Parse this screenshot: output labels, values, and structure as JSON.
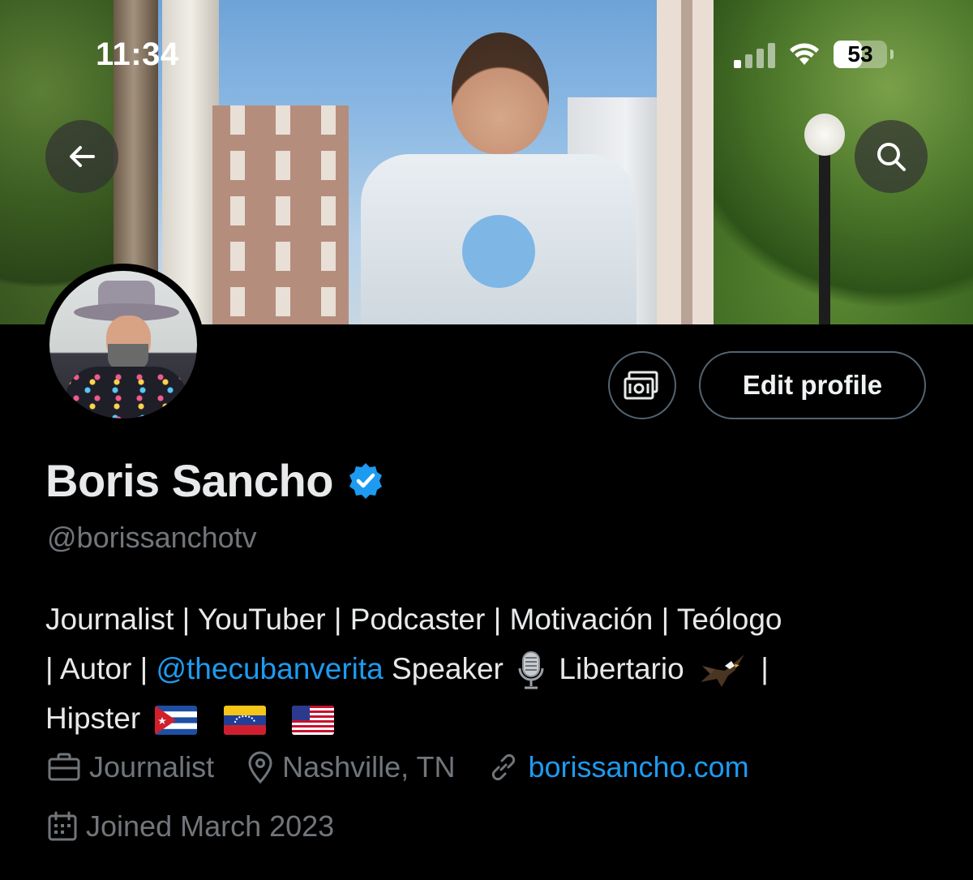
{
  "status_bar": {
    "time": "11:34",
    "battery": "53",
    "battery_level_percent": 53,
    "signal_bars_active": 1,
    "signal_bars_total": 4
  },
  "banner": {
    "description_icons": [
      "back-arrow-icon",
      "search-icon"
    ]
  },
  "profile": {
    "display_name": "Boris Sancho",
    "verified": true,
    "verified_color": "#1d9bf0",
    "handle": "@borissanchotv",
    "edit_button_label": "Edit profile",
    "bio_parts": {
      "line1": "Journalist | YouTuber | Podcaster | Motivación | Teólogo",
      "line2_prefix": "| Autor | ",
      "mention": "@thecubanverita",
      "line2_after_mention": " Speaker",
      "line2_after_mic": " Libertario",
      "line2_end": " |",
      "line3_prefix": "Hipster"
    },
    "bio_emoji": [
      "microphone-emoji",
      "eagle-emoji",
      "cuba-flag",
      "venezuela-flag",
      "usa-flag"
    ],
    "category": "Journalist",
    "location": "Nashville, TN",
    "website": "borissancho.com",
    "joined": "Joined March 2023"
  },
  "colors": {
    "background": "#000000",
    "text_primary": "#e7e9ea",
    "text_secondary": "#71767b",
    "link": "#1d9bf0",
    "button_border": "#536471"
  }
}
